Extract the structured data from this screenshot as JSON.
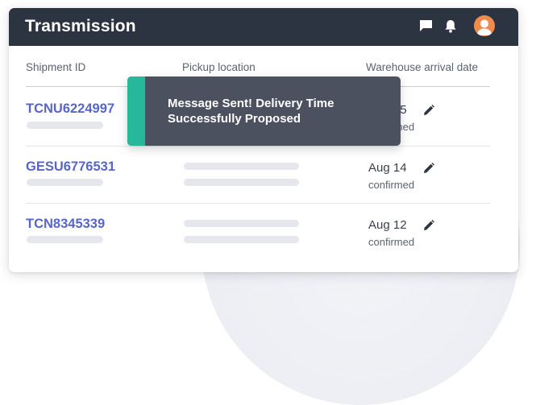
{
  "app": {
    "title": "Transmission"
  },
  "columns": [
    "Shipment ID",
    "Pickup location",
    "Warehouse arrival date"
  ],
  "rows": [
    {
      "shipment_id": "TCNU6224997",
      "date": "Aug 15",
      "status": "confirmed"
    },
    {
      "shipment_id": "GESU6776531",
      "date": "Aug 14",
      "status": "confirmed"
    },
    {
      "shipment_id": "TCN8345339",
      "date": "Aug 12",
      "status": "confirmed"
    }
  ],
  "toast": {
    "message": "Message Sent! Delivery Time Successfully Proposed"
  },
  "icons": {
    "chat": "chat-icon",
    "bell": "bell-icon",
    "avatar": "user-avatar",
    "edit": "pencil-icon"
  },
  "colors": {
    "header_bg": "#2c3442",
    "link": "#5865c9",
    "toast_bg": "#4c5160",
    "toast_accent": "#27b79a",
    "avatar": "#f08b4f"
  }
}
